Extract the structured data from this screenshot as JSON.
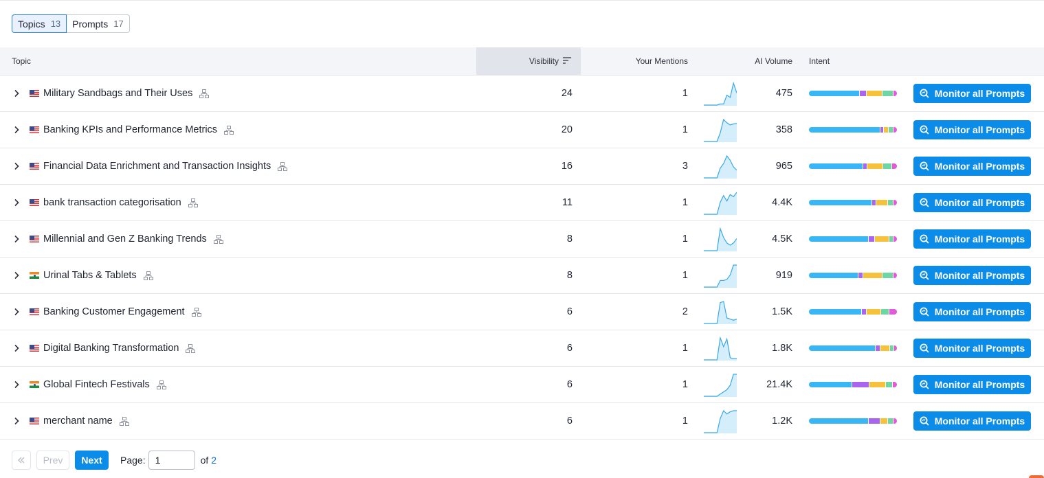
{
  "tabs": [
    {
      "label": "Topics",
      "count": "13"
    },
    {
      "label": "Prompts",
      "count": "17"
    }
  ],
  "columns": {
    "topic": "Topic",
    "visibility": "Visibility",
    "mentions": "Your Mentions",
    "volume": "AI Volume",
    "intent": "Intent"
  },
  "colors": {
    "accent": "#0c8ce9",
    "intent_info": "#38b6f5",
    "intent_nav": "#a964f0",
    "intent_comm": "#f7c23b",
    "intent_trans": "#6fd6a3",
    "intent_other": "#e05bd9",
    "spark_line": "#3aa8e6",
    "spark_fill": "#d4eefb"
  },
  "rows": [
    {
      "flag": "us",
      "topic": "Military Sandbags and Their Uses",
      "visibility": "24",
      "mentions": "1",
      "volume": "475",
      "intent": [
        0.59,
        0.07,
        0.18,
        0.12,
        0.04
      ],
      "trend": [
        0,
        0,
        0,
        0,
        0,
        0.05,
        0.05,
        0.45,
        0.35,
        1.0,
        0.55
      ]
    },
    {
      "flag": "us",
      "topic": "Banking KPIs and Performance Metrics",
      "visibility": "20",
      "mentions": "1",
      "volume": "358",
      "intent": [
        0.83,
        0.03,
        0.05,
        0.05,
        0.04
      ],
      "trend": [
        0,
        0,
        0,
        0,
        0,
        0.4,
        1.0,
        0.85,
        0.75,
        0.8,
        0.82
      ]
    },
    {
      "flag": "us",
      "topic": "Financial Data Enrichment and Transaction Insights",
      "visibility": "16",
      "mentions": "3",
      "volume": "965",
      "intent": [
        0.63,
        0.04,
        0.18,
        0.09,
        0.06
      ],
      "trend": [
        0,
        0,
        0,
        0,
        0,
        0.45,
        0.65,
        1.0,
        0.8,
        0.5,
        0.35
      ]
    },
    {
      "flag": "us",
      "topic": "bank transaction categorisation",
      "visibility": "11",
      "mentions": "1",
      "volume": "4.4K",
      "intent": [
        0.73,
        0.04,
        0.13,
        0.06,
        0.04
      ],
      "trend": [
        0,
        0,
        0,
        0,
        0,
        0.55,
        0.85,
        0.6,
        0.9,
        0.8,
        1.0
      ]
    },
    {
      "flag": "us",
      "topic": "Millennial and Gen Z Banking Trends",
      "visibility": "8",
      "mentions": "1",
      "volume": "4.5K",
      "intent": [
        0.69,
        0.07,
        0.16,
        0.04,
        0.04
      ],
      "trend": [
        0,
        0,
        0,
        0,
        0,
        1.0,
        0.6,
        0.35,
        0.25,
        0.35,
        0.55
      ]
    },
    {
      "flag": "in",
      "topic": "Urinal Tabs & Tablets",
      "visibility": "8",
      "mentions": "1",
      "volume": "919",
      "intent": [
        0.57,
        0.05,
        0.22,
        0.12,
        0.04
      ],
      "trend": [
        0,
        0,
        0,
        0,
        0,
        0.3,
        0.3,
        0.35,
        0.55,
        1.0,
        1.0
      ]
    },
    {
      "flag": "us",
      "topic": "Banking Customer Engagement",
      "visibility": "6",
      "mentions": "2",
      "volume": "1.5K",
      "intent": [
        0.61,
        0.05,
        0.16,
        0.09,
        0.09
      ],
      "trend": [
        0,
        0,
        0,
        0,
        0,
        0.95,
        1.0,
        0.25,
        0.2,
        0.15,
        0.2
      ]
    },
    {
      "flag": "us",
      "topic": "Digital Banking Transformation",
      "visibility": "6",
      "mentions": "1",
      "volume": "1.8K",
      "intent": [
        0.77,
        0.05,
        0.11,
        0.04,
        0.03
      ],
      "trend": [
        0,
        0,
        0,
        0,
        0,
        1.0,
        0.6,
        0.95,
        0.1,
        0.05,
        0.05
      ]
    },
    {
      "flag": "in",
      "topic": "Global Fintech Festivals",
      "visibility": "6",
      "mentions": "1",
      "volume": "21.4K",
      "intent": [
        0.5,
        0.19,
        0.19,
        0.07,
        0.05
      ],
      "trend": [
        0,
        0,
        0,
        0,
        0,
        0.1,
        0.2,
        0.3,
        0.5,
        1.0,
        1.0
      ]
    },
    {
      "flag": "us",
      "topic": "merchant name",
      "visibility": "6",
      "mentions": "1",
      "volume": "1.2K",
      "intent": [
        0.69,
        0.13,
        0.08,
        0.06,
        0.04
      ],
      "trend": [
        0,
        0,
        0,
        0,
        0,
        0.65,
        1.0,
        0.85,
        0.95,
        1.0,
        1.0
      ]
    }
  ],
  "row_button_label": "Monitor all Prompts",
  "pagination": {
    "prev": "Prev",
    "next": "Next",
    "page_label": "Page:",
    "page_value": "1",
    "of_label": "of",
    "total_pages": "2"
  }
}
